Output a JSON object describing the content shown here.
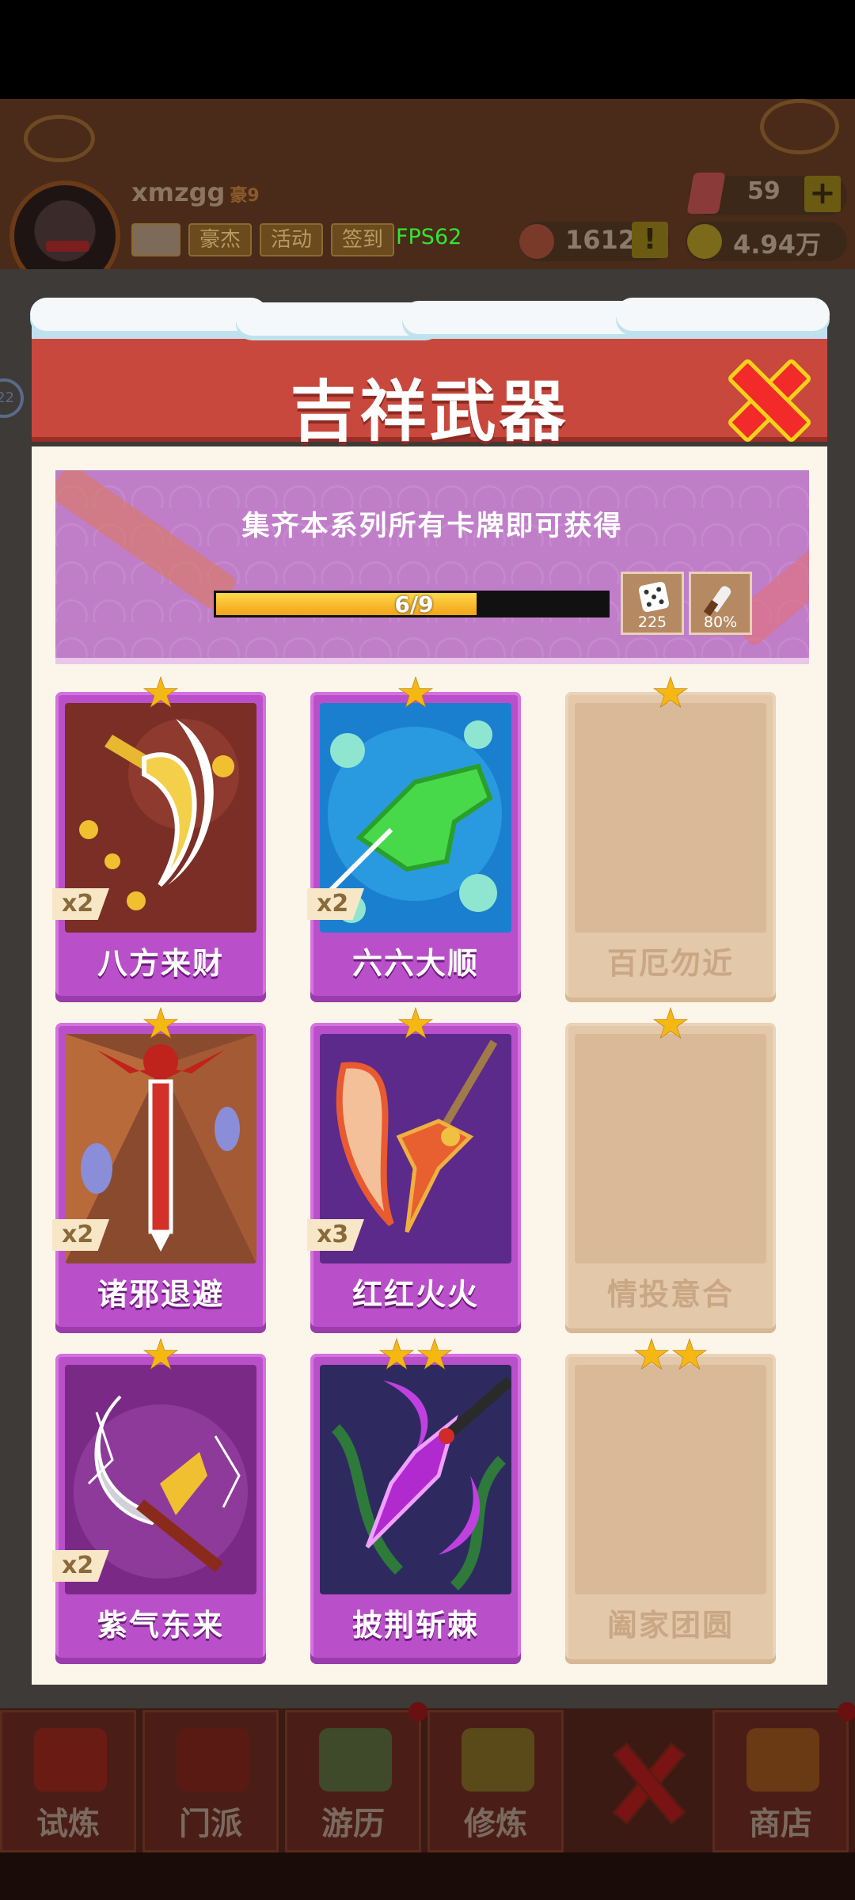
{
  "hud": {
    "player_name": "xmzgg",
    "player_tag": "豪9",
    "buttons": [
      "豪杰",
      "活动",
      "签到"
    ],
    "fps": "FPS62",
    "gems": "59",
    "plus": "+",
    "tokens": "1612",
    "alert": "!",
    "coins": "4.94万",
    "side_badge": "22"
  },
  "modal": {
    "title": "吉祥武器",
    "close_icon": "close-icon",
    "banner_text": "集齐本系列所有卡牌即可获得",
    "progress_text": "6/9",
    "progress_fraction": 0.6667,
    "rewards": [
      {
        "icon": "dice-icon",
        "label": "225"
      },
      {
        "icon": "knife-icon",
        "label": "80%"
      }
    ],
    "cards": [
      {
        "name": "八方来财",
        "stars": 1,
        "multiplier": "x2",
        "locked": false,
        "art": "golden-axe"
      },
      {
        "name": "六六大顺",
        "stars": 1,
        "multiplier": "x2",
        "locked": false,
        "art": "green-hand"
      },
      {
        "name": "百厄勿近",
        "stars": 1,
        "multiplier": "",
        "locked": true,
        "art": ""
      },
      {
        "name": "诸邪退避",
        "stars": 1,
        "multiplier": "x2",
        "locked": false,
        "art": "red-sword"
      },
      {
        "name": "红红火火",
        "stars": 1,
        "multiplier": "x3",
        "locked": false,
        "art": "fire-spear"
      },
      {
        "name": "情投意合",
        "stars": 1,
        "multiplier": "",
        "locked": true,
        "art": ""
      },
      {
        "name": "紫气东来",
        "stars": 1,
        "multiplier": "x2",
        "locked": false,
        "art": "lightning-blade"
      },
      {
        "name": "披荆斩棘",
        "stars": 2,
        "multiplier": "",
        "locked": false,
        "art": "thorn-spear"
      },
      {
        "name": "阖家团圆",
        "stars": 2,
        "multiplier": "",
        "locked": true,
        "art": ""
      }
    ]
  },
  "bottom_nav": [
    "试炼",
    "门派",
    "游历",
    "修炼",
    "",
    "商店"
  ],
  "colors": {
    "header_red": "#c9483d",
    "card_purple": "#b950c9",
    "locked_tan": "#e3c8aa",
    "star_gold": "#f5b812",
    "close_red": "#f22a2a"
  }
}
